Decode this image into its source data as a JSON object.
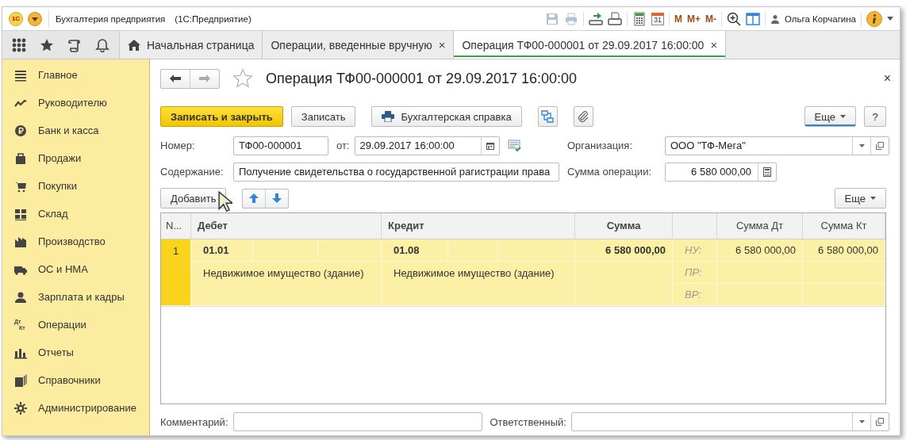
{
  "window": {
    "logo": "1С",
    "title": "Бухгалтерия предприятия",
    "subtitle": "(1С:Предприятие)"
  },
  "toolbar": [
    {
      "kind": "icon",
      "disabled": true
    },
    {
      "kind": "icon",
      "disabled": true
    },
    {
      "kind": "separator"
    },
    {
      "kind": "icon",
      "disabled": false
    },
    {
      "kind": "icon",
      "disabled": false
    },
    {
      "kind": "separator"
    },
    {
      "kind": "icon",
      "disabled": false
    },
    {
      "kind": "calendar",
      "text": "31"
    },
    {
      "kind": "separator"
    },
    {
      "kind": "text",
      "text": "M"
    },
    {
      "kind": "text",
      "text": "M+"
    },
    {
      "kind": "text",
      "text": "M-"
    },
    {
      "kind": "separator"
    },
    {
      "kind": "icon",
      "disabled": false
    },
    {
      "kind": "icon",
      "disabled": false
    },
    {
      "kind": "separator"
    }
  ],
  "user": {
    "name": "Ольга Корчагина"
  },
  "nav_tabs": [
    {
      "label": "Начальная страница",
      "selected": false,
      "closable": false
    },
    {
      "label": "Операции, введенные вручную",
      "selected": false,
      "closable": true
    },
    {
      "label": "Операция ТФ00-000001 от 29.09.2017 16:00:00",
      "selected": true,
      "closable": true
    }
  ],
  "close_glyph": "×",
  "sidebar": {
    "items": [
      {
        "label": "Главное"
      },
      {
        "label": "Руководителю"
      },
      {
        "label": "Банк и касса"
      },
      {
        "label": "Продажи"
      },
      {
        "label": "Покупки"
      },
      {
        "label": "Склад"
      },
      {
        "label": "Производство"
      },
      {
        "label": "ОС и НМА"
      },
      {
        "label": "Зарплата и кадры"
      },
      {
        "label": "Операции",
        "icon_text": [
          "Дт",
          "Кт"
        ]
      },
      {
        "label": "Отчеты"
      },
      {
        "label": "Справочники"
      },
      {
        "label": "Администрирование"
      }
    ]
  },
  "form": {
    "title": "Операция ТФ00-000001 от 29.09.2017 16:00:00",
    "favorite": false,
    "commands": {
      "primary": "Записать и закрыть",
      "save": "Записать",
      "report": "Бухгалтерская справка",
      "more": "Еще",
      "help": "?"
    },
    "number": {
      "label": "Номер:",
      "value": "ТФ00-000001"
    },
    "date": {
      "label": "от:",
      "value": "29.09.2017 16:00:00"
    },
    "organization": {
      "label": "Организация:",
      "value": "ООО \"ТФ-Мега\""
    },
    "content": {
      "label": "Содержание:",
      "value": "Получение свидетельства о государственной рагистрации права"
    },
    "amount": {
      "label": "Сумма операции:",
      "value": "6 580 000,00"
    },
    "table_commands": {
      "add": "Добавить",
      "more": "Еще"
    },
    "table": {
      "columns": [
        "N...",
        "Дебет",
        "Кредит",
        "Сумма",
        "",
        "Сумма Дт",
        "Сумма Кт"
      ],
      "rows": [
        {
          "number": "1",
          "selected": true,
          "debit": {
            "account": "01.01",
            "subconto": "Недвижимое имущество (здание)"
          },
          "credit": {
            "account": "01.08",
            "subconto": "Недвижимое имущество (здание)"
          },
          "amount": "6 580 000,00",
          "lines": [
            {
              "label": "НУ:",
              "amount_dt": "6 580 000,00",
              "amount_kt": "6 580 000,00"
            },
            {
              "label": "ПР:"
            },
            {
              "label": "ВР:"
            }
          ]
        }
      ]
    },
    "comment": {
      "label": "Комментарий:"
    },
    "responsible": {
      "label": "Ответственный:"
    }
  }
}
